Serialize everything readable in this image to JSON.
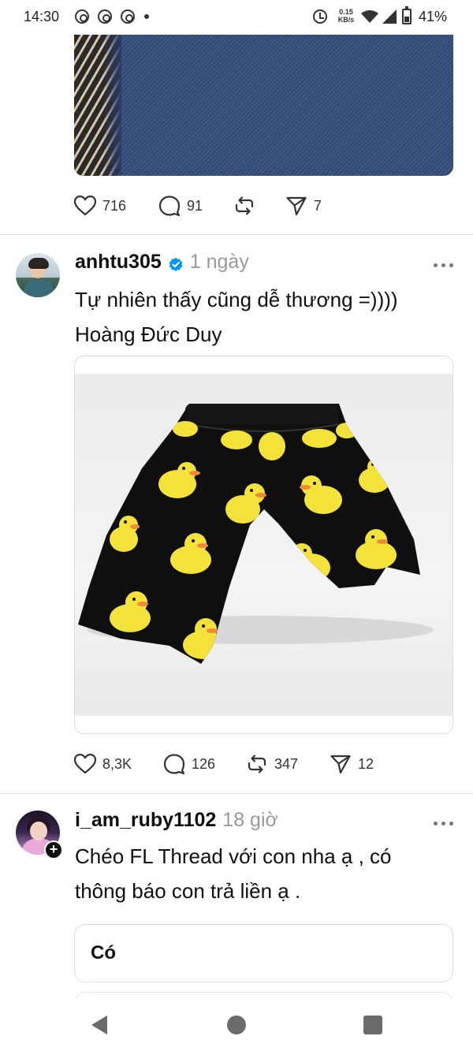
{
  "status_bar": {
    "time": "14:30",
    "net_speed_value": "0.15",
    "net_speed_unit": "KB/s",
    "battery": "41%",
    "battery_level": 0.41,
    "notification_icons": [
      "threads-icon",
      "threads-icon",
      "threads-icon"
    ]
  },
  "posts": [
    {
      "image": "denim-fabric-photo",
      "stats": {
        "likes": "716",
        "comments": "91",
        "reposts": "",
        "shares": "7"
      }
    },
    {
      "username": "anhtu305",
      "verified": true,
      "time": "1 ngày",
      "text_line_1": "Tự nhiên thấy cũng dễ thương =))))",
      "text_line_2": "Hoàng Đức Duy",
      "image": "duck-print-shorts-photo",
      "stats": {
        "likes": "8,3K",
        "comments": "126",
        "reposts": "347",
        "shares": "12"
      }
    },
    {
      "username": "i_am_ruby1102",
      "time": "18 giờ",
      "text_line_1": "Chéo FL Thread với con nha ạ , có",
      "text_line_2": "thông báo con trả liền ạ .",
      "reply_preview": "Có"
    }
  ],
  "colors": {
    "text": "#101010",
    "muted": "#9a9a9a",
    "verified": "#0095f6",
    "duck_yellow": "#f2e23a",
    "duck_beak": "#f08a3a"
  }
}
